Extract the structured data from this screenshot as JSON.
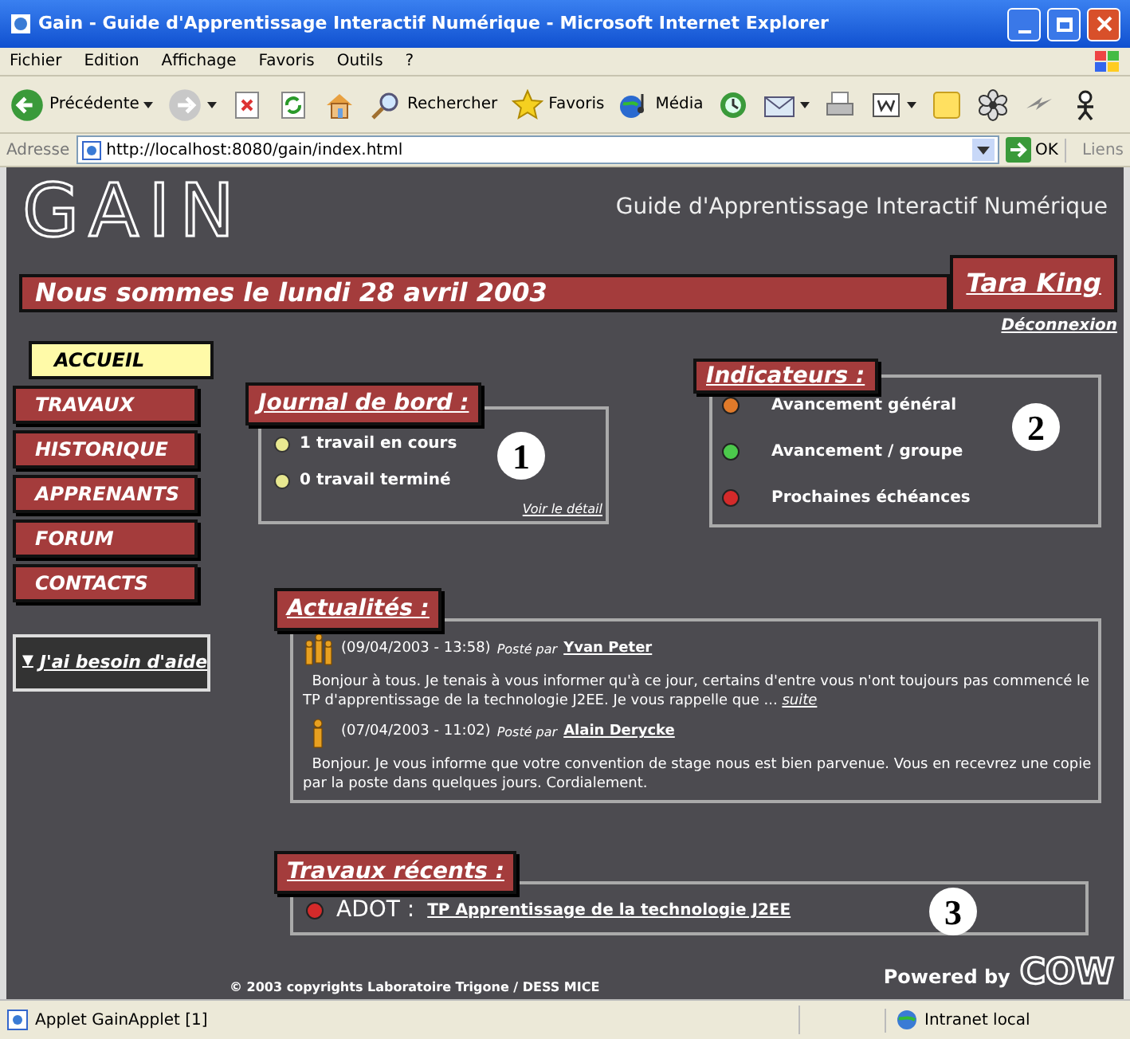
{
  "window": {
    "title": "Gain - Guide d'Apprentissage Interactif Numérique - Microsoft Internet Explorer"
  },
  "menu": [
    "Fichier",
    "Edition",
    "Affichage",
    "Favoris",
    "Outils",
    "?"
  ],
  "toolbar": [
    "Précédente",
    "Rechercher",
    "Favoris",
    "Média"
  ],
  "address": {
    "label": "Adresse",
    "url": "http://localhost:8080/gain/index.html",
    "go": "OK",
    "links": "Liens"
  },
  "header": {
    "logo": "GAIN",
    "subtitle": "Guide d'Apprentissage Interactif Numérique",
    "date": "Nous sommes le lundi 28 avril 2003",
    "user": "Tara King",
    "logout": "Déconnexion"
  },
  "nav": [
    {
      "label": "ACCUEIL",
      "selected": true
    },
    {
      "label": "TRAVAUX",
      "selected": false
    },
    {
      "label": "HISTORIQUE",
      "selected": false
    },
    {
      "label": "APPRENANTS",
      "selected": false
    },
    {
      "label": "FORUM",
      "selected": false
    },
    {
      "label": "CONTACTS",
      "selected": false
    }
  ],
  "help": {
    "marker": "▼",
    "label": "J'ai besoin d'aide"
  },
  "journal": {
    "title": "Journal de bord :",
    "items": [
      "1 travail en cours",
      "0 travail terminé"
    ],
    "detail": "Voir le détail",
    "number": "1"
  },
  "indicators": {
    "title": "Indicateurs :",
    "items": [
      {
        "label": "Avancement général",
        "color": "#e07a2a"
      },
      {
        "label": "Avancement / groupe",
        "color": "#4cc94c"
      },
      {
        "label": "Prochaines échéances",
        "color": "#d42a2a"
      }
    ],
    "number": "2"
  },
  "news": {
    "title": "Actualités :",
    "posts": [
      {
        "kind": "group",
        "date": "(09/04/2003 - 13:58)",
        "posted_by": "Posté par",
        "author": "Yvan Peter",
        "body": "Bonjour à tous. Je tenais à vous informer qu'à ce jour, certains d'entre vous n'ont toujours pas commencé le TP d'apprentissage de la technologie J2EE. Je vous rappelle que ...",
        "more": "suite"
      },
      {
        "kind": "single",
        "date": "(07/04/2003 - 11:02)",
        "posted_by": "Posté par",
        "author": "Alain Derycke",
        "body": "Bonjour. Je vous informe que votre convention de stage nous est bien parvenue. Vous en recevrez une copie par la poste dans quelques jours. Cordialement."
      }
    ]
  },
  "recent": {
    "title": "Travaux récents :",
    "items": [
      {
        "code": "ADOT :",
        "title": "TP Apprentissage de la technologie J2EE",
        "color": "#d42a2a"
      }
    ],
    "number": "3"
  },
  "footer": {
    "copyright": "© 2003 copyrights Laboratoire Trigone / DESS MICE",
    "powered": "Powered by",
    "brand": "COW"
  },
  "status": {
    "text": "Applet GainApplet [1]",
    "zone": "Intranet local"
  }
}
